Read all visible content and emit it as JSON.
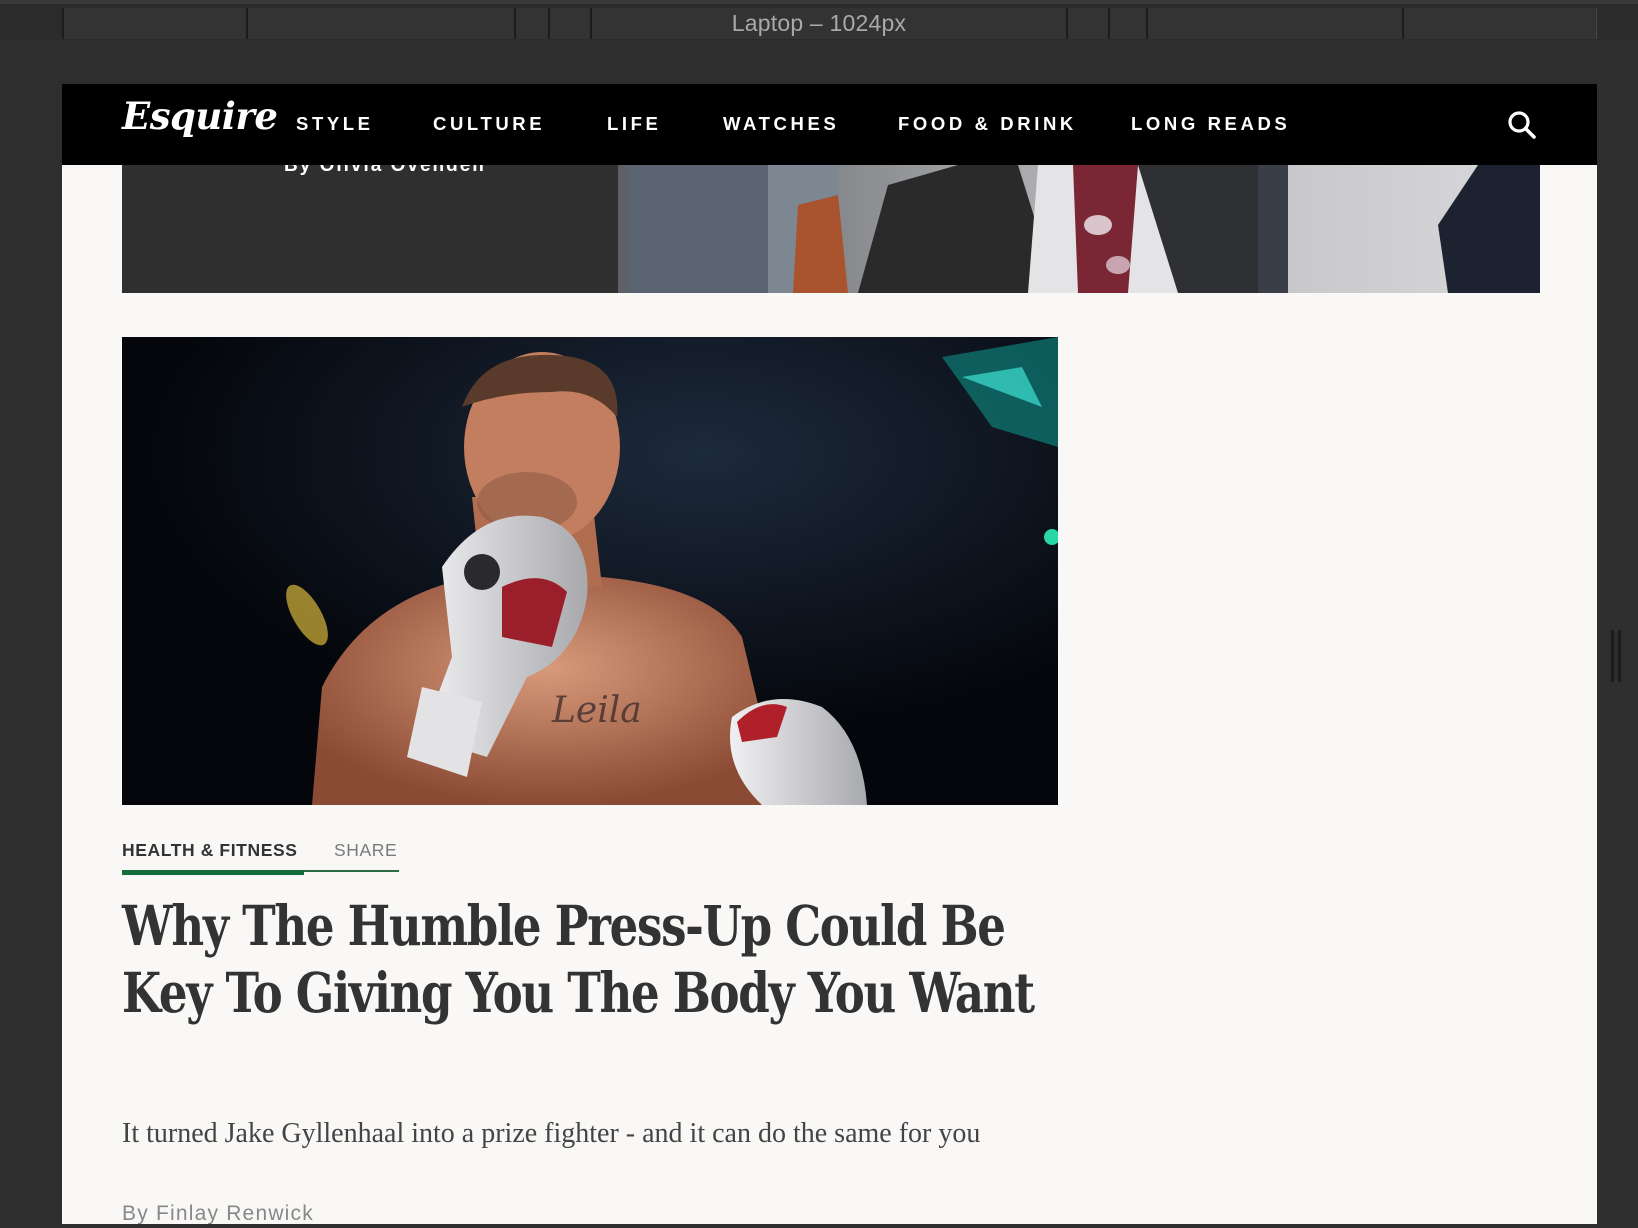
{
  "device_toolbar": {
    "title": "Laptop – 1024px"
  },
  "site": {
    "logo": "Esquire",
    "nav": {
      "items": [
        {
          "label": "STYLE"
        },
        {
          "label": "CULTURE"
        },
        {
          "label": "LIFE"
        },
        {
          "label": "WATCHES"
        },
        {
          "label": "FOOD & DRINK"
        },
        {
          "label": "LONG READS"
        }
      ],
      "search_icon": "search-icon"
    }
  },
  "previous_article": {
    "byline": "By Olivia Ovenden"
  },
  "article": {
    "category": "HEALTH & FITNESS",
    "share_label": "SHARE",
    "headline": "Why The Humble Press-Up Could Be Key To Giving You The Body You Want",
    "standfirst": "It turned Jake Gyllenhaal into a prize fighter - and it can do the same for you",
    "author": "By Finlay Renwick",
    "image_tattoo_text": "Leila"
  },
  "colors": {
    "nav_bg": "#000000",
    "page_bg": "#f9f8f6",
    "accent_green": "#166b3c",
    "headline_text": "#333333"
  }
}
